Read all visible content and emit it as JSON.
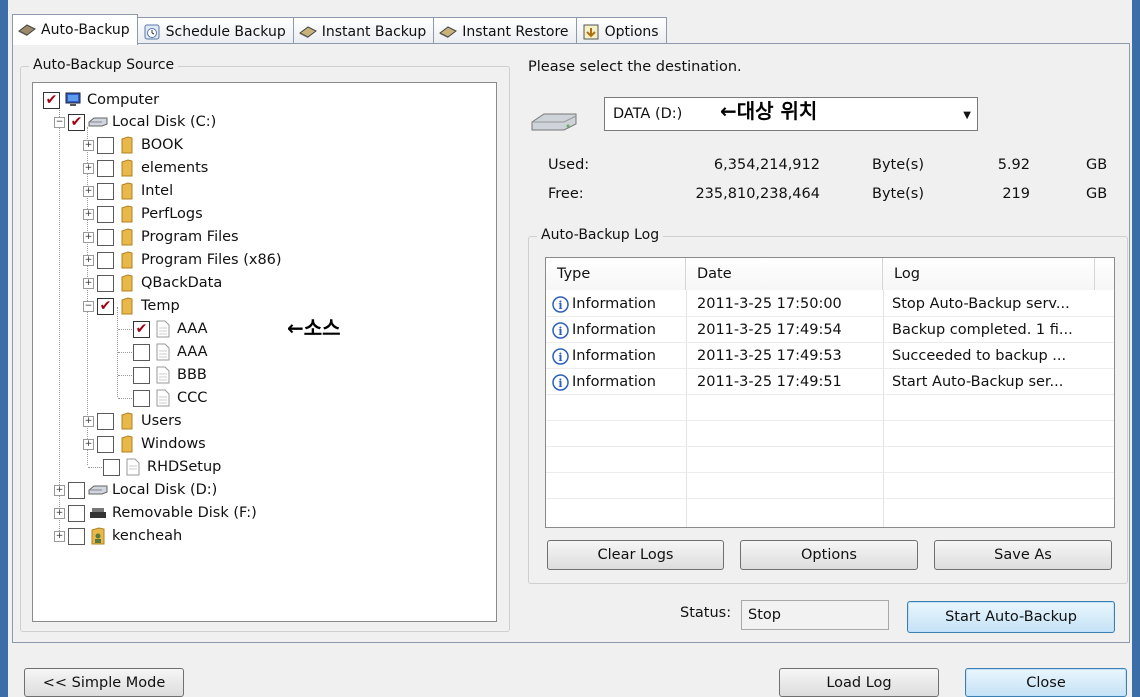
{
  "tabs": [
    {
      "label": "Auto-Backup",
      "icon": "backup-icon",
      "active": true
    },
    {
      "label": "Schedule Backup",
      "icon": "schedule-icon",
      "active": false
    },
    {
      "label": "Instant Backup",
      "icon": "instant-backup-icon",
      "active": false
    },
    {
      "label": "Instant Restore",
      "icon": "instant-restore-icon",
      "active": false
    },
    {
      "label": "Options",
      "icon": "options-icon",
      "active": false
    }
  ],
  "source": {
    "group_title": "Auto-Backup Source",
    "annotation": "←소스",
    "tree": [
      {
        "label": "Computer",
        "icon": "computer-icon",
        "checked": true
      },
      {
        "label": "Local Disk (C:)",
        "icon": "drive-icon",
        "checked": true
      },
      {
        "label": "BOOK",
        "icon": "folder-icon",
        "checked": false
      },
      {
        "label": "elements",
        "icon": "folder-icon",
        "checked": false
      },
      {
        "label": "Intel",
        "icon": "folder-icon",
        "checked": false
      },
      {
        "label": "PerfLogs",
        "icon": "folder-icon",
        "checked": false
      },
      {
        "label": "Program Files",
        "icon": "folder-icon",
        "checked": false
      },
      {
        "label": "Program Files (x86)",
        "icon": "folder-icon",
        "checked": false
      },
      {
        "label": "QBackData",
        "icon": "folder-icon",
        "checked": false
      },
      {
        "label": "Temp",
        "icon": "folder-icon",
        "checked": true
      },
      {
        "label": "AAA",
        "icon": "file-icon",
        "checked": true
      },
      {
        "label": "AAA",
        "icon": "file-icon",
        "checked": false
      },
      {
        "label": "BBB",
        "icon": "file-icon",
        "checked": false
      },
      {
        "label": "CCC",
        "icon": "file-icon",
        "checked": false
      },
      {
        "label": "Users",
        "icon": "folder-icon",
        "checked": false
      },
      {
        "label": "Windows",
        "icon": "folder-icon",
        "checked": false
      },
      {
        "label": "RHDSetup",
        "icon": "file-icon",
        "checked": false
      },
      {
        "label": "Local Disk (D:)",
        "icon": "drive-icon",
        "checked": false
      },
      {
        "label": "Removable Disk (F:)",
        "icon": "removable-drive-icon",
        "checked": false
      },
      {
        "label": "kencheah",
        "icon": "user-folder-icon",
        "checked": false
      }
    ]
  },
  "destination": {
    "prompt": "Please select the destination.",
    "selected": "DATA (D:)",
    "annotation": "←대상 위치",
    "used_label": "Used:",
    "used_bytes": "6,354,214,912",
    "used_unit": "Byte(s)",
    "used_size": "5.92",
    "used_size_unit": "GB",
    "free_label": "Free:",
    "free_bytes": "235,810,238,464",
    "free_unit": "Byte(s)",
    "free_size": "219",
    "free_size_unit": "GB"
  },
  "log": {
    "group_title": "Auto-Backup Log",
    "columns": [
      "Type",
      "Date",
      "Log"
    ],
    "rows": [
      {
        "type": "Information",
        "date": "2011-3-25 17:50:00",
        "log": "Stop Auto-Backup serv..."
      },
      {
        "type": "Information",
        "date": "2011-3-25 17:49:54",
        "log": "Backup completed. 1 fi..."
      },
      {
        "type": "Information",
        "date": "2011-3-25 17:49:53",
        "log": "Succeeded to backup ..."
      },
      {
        "type": "Information",
        "date": "2011-3-25 17:49:51",
        "log": "Start Auto-Backup ser..."
      }
    ],
    "clear_label": "Clear Logs",
    "options_label": "Options",
    "save_label": "Save As"
  },
  "status": {
    "label": "Status:",
    "value": "Stop",
    "start_label": "Start Auto-Backup"
  },
  "footer": {
    "simple_mode_label": "<< Simple Mode",
    "load_log_label": "Load Log",
    "close_label": "Close"
  },
  "colors": {
    "window_frame": "#3b6ea8",
    "checkmark": "#a00010",
    "folder": "#e8b84a",
    "info": "#2c5fb8"
  }
}
